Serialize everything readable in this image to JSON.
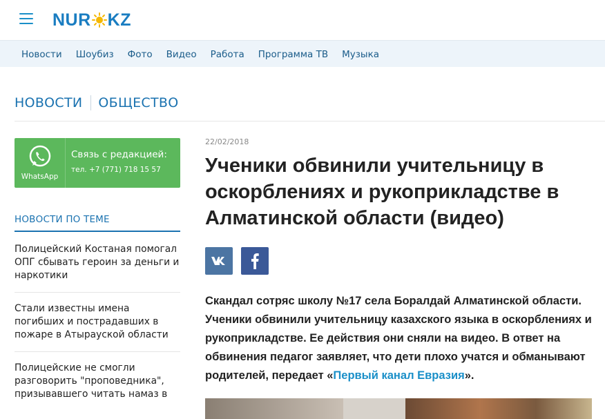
{
  "header": {
    "logo_left": "NUR",
    "logo_right": "KZ"
  },
  "nav": {
    "items": [
      "Новости",
      "Шоубиз",
      "Фото",
      "Видео",
      "Работа",
      "Программа ТВ",
      "Музыка"
    ]
  },
  "breadcrumbs": [
    "НОВОСТИ",
    "ОБЩЕСТВО"
  ],
  "whatsapp": {
    "label": "WhatsApp",
    "title": "Связь с редакцией:",
    "phone": "тел. +7 (771) 718 15 57",
    "color": "#5cb85c"
  },
  "related": {
    "title": "НОВОСТИ ПО ТЕМЕ",
    "items": [
      "Полицейский Костаная помогал ОПГ сбывать героин за деньги и наркотики",
      "Стали известны имена погибших и пострадавших в пожаре в Атырауской области",
      "Полицейские не смогли разговорить \"проповедника\", призывавшего читать намаз в"
    ]
  },
  "article": {
    "date": "22/02/2018",
    "headline": "Ученики обвинили учительницу в оскорблениях и рукоприкладстве в Алматинской области (видео)",
    "lead_text": "Скандал сотряс школу №17 села Боралдай Алматинской области. Ученики обвинили учительницу казахского языка в оскорблениях и рукоприкладстве. Ее действия они сняли на видео. В ответ на обвинения педагог заявляет, что дети плохо учатся и обманывают родителей, передает «",
    "lead_link": "Первый канал Евразия",
    "lead_end": "»."
  },
  "share": {
    "vk_icon": "vk-icon",
    "fb_icon": "facebook-icon",
    "vk_color": "#4c75a3",
    "fb_color": "#3b5998"
  },
  "colors": {
    "accent": "#1a72b0",
    "link": "#1a8fc8",
    "nav_bg": "#edf4fa"
  }
}
